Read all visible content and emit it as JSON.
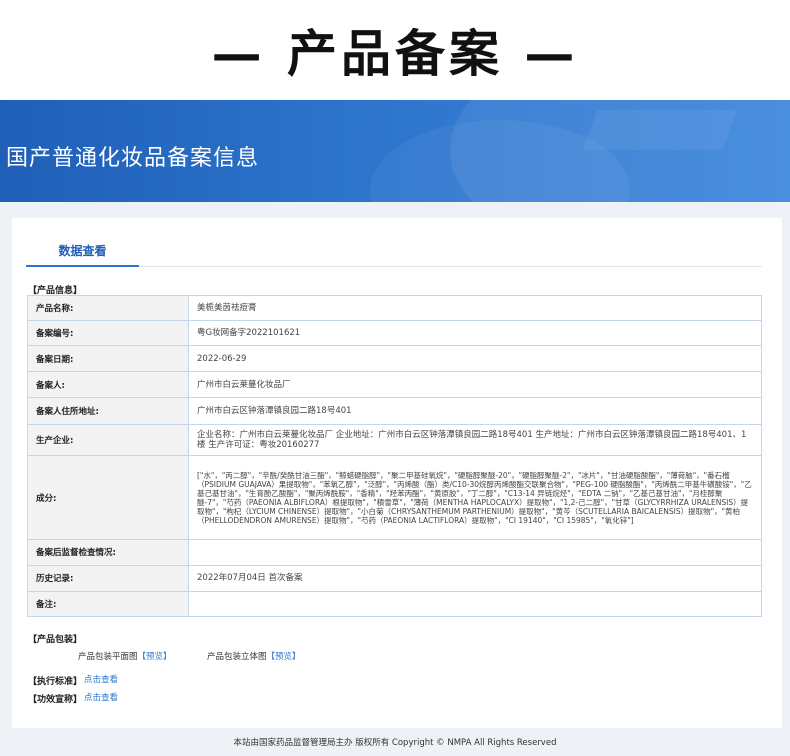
{
  "heading": "— 产品备案 —",
  "banner": {
    "title": "国产普通化妆品备案信息"
  },
  "tabs": [
    {
      "label": "数据查看",
      "active": true
    }
  ],
  "product_info": {
    "section_label": "【产品信息】",
    "rows": [
      {
        "key": "产品名称:",
        "value": "美栀美茵祛痘膏"
      },
      {
        "key": "备案编号:",
        "value": "粤G妆网备字2022101621"
      },
      {
        "key": "备案日期:",
        "value": "2022-06-29"
      },
      {
        "key": "备案人:",
        "value": "广州市白云莱蔓化妆品厂"
      },
      {
        "key": "备案人住所地址:",
        "value": "广州市白云区钟落潭镇良园二路18号401"
      },
      {
        "key": "生产企业:",
        "value": "企业名称：广州市白云莱蔓化妆品厂 企业地址：广州市白云区钟落潭镇良园二路18号401 生产地址：广州市白云区钟落潭镇良园二路18号401、1楼 生产许可证：粤妆20160277"
      },
      {
        "key": "成分:",
        "value": "[\"水\"，\"丙二醇\"，\"辛酰/癸酰甘油三酯\"，\"鲸蜡硬脂醇\"，\"聚二甲基硅氧烷\"，\"硬脂醇聚醚-20\"，\"硬脂醇聚醚-2\"，\"冰片\"，\"甘油硬脂酸酯\"，\"薄荷脑\"，\"番石榴（PSIDIUM GUAJAVA）果提取物\"，\"苯氧乙醇\"，\"泛醇\"，\"丙烯酸（酯）类/C10-30烷醇丙烯酸酯交联聚合物\"，\"PEG-100 硬脂酸酯\"，\"丙烯酰二甲基牛磺酸铵\"，\"乙基己基甘油\"，\"生育酚乙酸酯\"，\"聚丙烯酰胺\"，\"香精\"，\"羟苯丙酯\"，\"黄原胶\"，\"丁二醇\"，\"C13-14 异链烷烃\"，\"EDTA 二钠\"，\"乙基己基甘油\"，\"月桂醇聚醚-7\"，\"芍药（PAEONIA ALBIFLORA）根提取物\"，\"積雪草\"，\"薄荷（MENTHA HAPLOCALYX）提取物\"，\"1,2-己二醇\"，\"甘草（GLYCYRRHIZA URALENSIS）提取物\"，\"枸杞（LYCIUM CHINENSE）提取物\"，\"小白菊（CHRYSANTHEMUM PARTHENIUM）提取物\"，\"黄芩（SCUTELLARIA BAICALENSIS）提取物\"，\"黄柏（PHELLODENDRON AMURENSE）提取物\"，\"芍药（PAEONIA LACTIFLORA）提取物\"，\"CI 19140\"，\"CI 15985\"，\"氧化锌\"]"
      },
      {
        "key": "备案后监督检查情况:",
        "value": ""
      },
      {
        "key": "历史记录:",
        "value": "2022年07月04日 首次备案"
      },
      {
        "key": "备注:",
        "value": ""
      }
    ]
  },
  "packaging": {
    "section_label": "【产品包装】",
    "flat_label": "产品包装平面图",
    "solid_label": "产品包装立体图",
    "preview_link": "【预览】"
  },
  "standard": {
    "label": "【执行标准】",
    "link": "点击查看"
  },
  "efficacy": {
    "label": "【功效宣称】",
    "link": "点击查看"
  },
  "footer": {
    "text": "本站由国家药品监督管理局主办 版权所有 Copyright © NMPA All Rights Reserved"
  },
  "colors": {
    "accent": "#2d74cc",
    "banner_start": "#1f5fb8",
    "banner_end": "#3d86dc",
    "table_border": "#a9c2e6"
  }
}
